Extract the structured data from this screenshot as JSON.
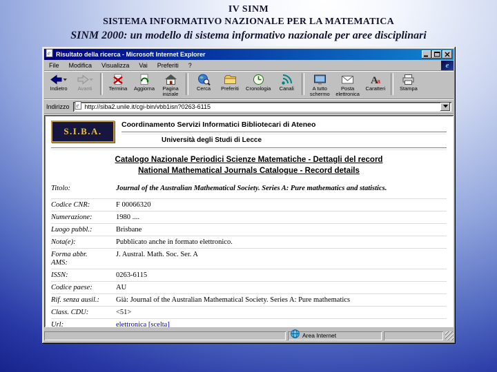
{
  "slide": {
    "line1": "IV SINM",
    "line2": "SISTEMA INFORMATIVO NAZIONALE PER LA MATEMATICA",
    "line3": "SINM 2000: un modello di sistema informativo nazionale per aree disciplinari"
  },
  "win": {
    "title": "Risultato della ricerca - Microsoft Internet Explorer",
    "menu": [
      "File",
      "Modifica",
      "Visualizza",
      "Vai",
      "Preferiti",
      "?"
    ],
    "toolbar": [
      "Indietro",
      "Avanti",
      "Termina",
      "Aggiorna",
      "Pagina\niniziale",
      "Cerca",
      "Preferiti",
      "Cronologia",
      "Canali",
      "A tutto\nschermo",
      "Posta\nelettronica",
      "Caratteri",
      "Stampa"
    ],
    "throbber": "e",
    "address_label": "Indirizzo",
    "url": "http://siba2.unile.it/cgi-bin/vbb1isn?0263-6115",
    "status_zone": "Area Internet"
  },
  "page": {
    "logo": "S.I.B.A.",
    "header_line1": "Coordinamento Servizi Informatici Bibliotecari di Ateneo",
    "header_line2": "Università degli Studi di Lecce",
    "title_it": "Catalogo Nazionale Periodici Scienze Matematiche - Dettagli del record",
    "title_en": "National Mathematical Journals Catalogue - Record details",
    "record": [
      {
        "label": "Titolo:",
        "value": "Journal of the Australian Mathematical Society. Series A: Pure mathematics and statistics."
      },
      {
        "label": "Codice CNR:",
        "value": "F 00066320"
      },
      {
        "label": "Numerazione:",
        "value": "1980 ...."
      },
      {
        "label": "Luogo pubbl.:",
        "value": "Brisbane"
      },
      {
        "label": "Nota(e):",
        "value": "Pubblicato anche in formato elettronico."
      },
      {
        "label": "Forma abbr.\nAMS:",
        "value": "J. Austral. Math. Soc. Ser. A"
      },
      {
        "label": "ISSN:",
        "value": "0263-6115"
      },
      {
        "label": "Codice paese:",
        "value": "AU"
      },
      {
        "label": "Rif. senza ausil.:",
        "value": "Già: Journal of the Australian Mathematical Society. Series A: Pure mathematics"
      },
      {
        "label": "Class. CDU:",
        "value": "<51>"
      },
      {
        "label": "Url:",
        "value": "elettronica [scelta]"
      }
    ]
  },
  "icons": {
    "ie-document-icon": "page-with-e",
    "minimize-icon": "underscore",
    "maximize-icon": "square",
    "close-icon": "x",
    "ie-logo-icon": "blue-e",
    "back-icon": "left-arrow",
    "forward-icon": "right-arrow",
    "stop-icon": "page-red-x",
    "refresh-icon": "page-green-arrows",
    "home-icon": "house",
    "search-icon": "globe-magnifier",
    "favorites-icon": "folder",
    "history-icon": "clock",
    "channels-icon": "satellite-waves",
    "fullscreen-icon": "monitor",
    "mail-icon": "envelope",
    "fonts-icon": "letter-a",
    "print-icon": "printer",
    "globe-icon": "globe",
    "dropdown-icon": "down-triangle"
  }
}
